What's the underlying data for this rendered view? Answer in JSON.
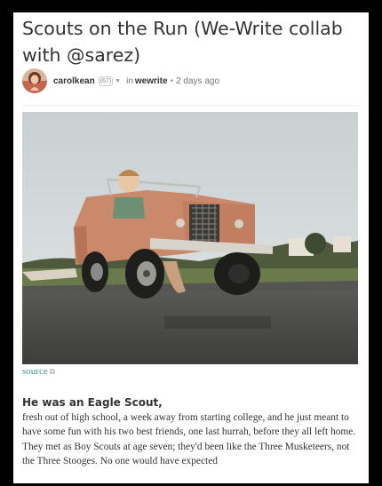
{
  "post": {
    "title": "Scouts on the Run (We-Write collab with @sarez)",
    "author": "carolkean",
    "reputation": "(67)",
    "in_label": "in",
    "community": "wewrite",
    "separator": "•",
    "age": "2 days ago",
    "image_alt": "child driving a small toy jeep on an asphalt road",
    "source_label": "source",
    "heading": "He was an Eagle Scout,",
    "body": "fresh out of high school, a week away from starting college, and he just meant to have some fun with his two best friends, one last hurrah, before they all left home. They met as Boy Scouts at age seven; they'd been like the Three Musketeers, not the Three Stooges. No one would have expected"
  },
  "icons": {
    "dropdown": "chevron-down-icon",
    "external_link": "external-link-icon"
  },
  "colors": {
    "page_background": "#000000",
    "card_background": "#ffffff",
    "text": "#333333",
    "muted": "#777777",
    "source_link": "#3a9a8a",
    "toy_car": "#c9896a"
  }
}
